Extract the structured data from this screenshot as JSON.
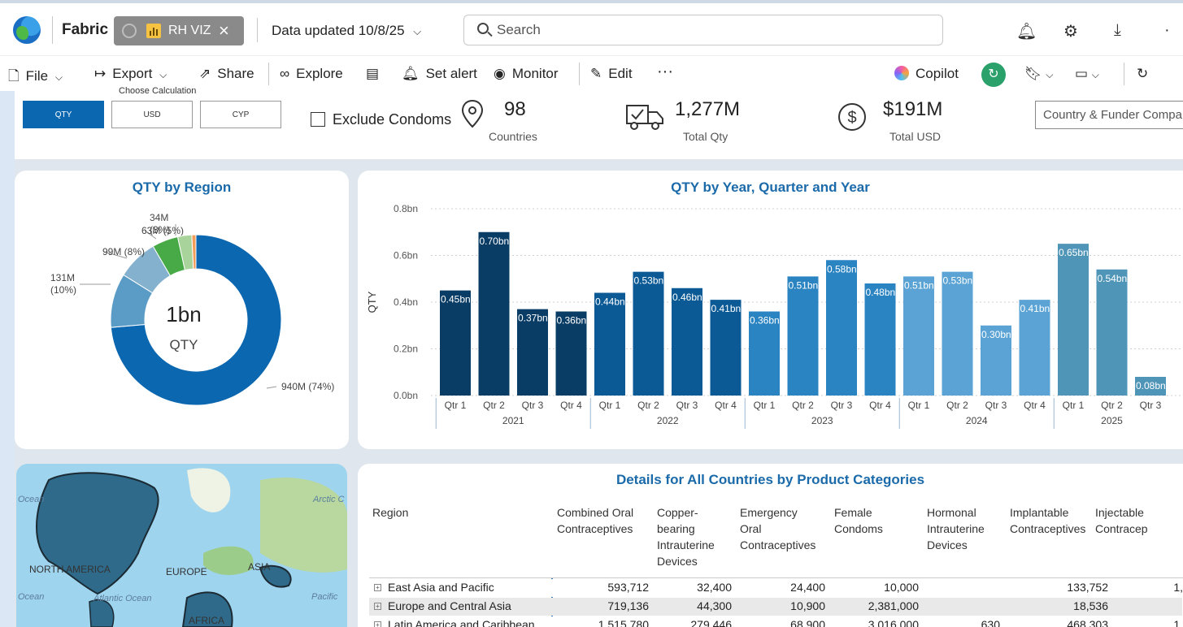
{
  "app": {
    "brand": "Fabric",
    "tab_label": "RH VIZ",
    "data_updated": "Data updated 10/8/25",
    "search_placeholder": "Search"
  },
  "ribbon": {
    "file": "File",
    "export": "Export",
    "share": "Share",
    "explore": "Explore",
    "set_alert": "Set alert",
    "monitor": "Monitor",
    "edit": "Edit",
    "more": "···",
    "copilot": "Copilot"
  },
  "icons": [
    "bell-icon",
    "gear-icon",
    "download-icon",
    "more-icon",
    "file-icon",
    "export-icon",
    "share-icon",
    "binoculars-icon",
    "explore-icon",
    "alert-icon",
    "monitor-icon",
    "edit-icon",
    "copilot-icon",
    "refresh-icon",
    "bookmark-icon",
    "view-icon",
    "reload-icon",
    "location-icon",
    "truck-icon",
    "dollar-icon"
  ],
  "filters": {
    "calc_label": "Choose Calculation",
    "calc_buttons": [
      "QTY",
      "USD",
      "CYP"
    ],
    "calc_selected": "QTY",
    "exclude_label": "Exclude Condoms",
    "exclude_checked": false,
    "slicer_placeholder": "Country & Funder Compa"
  },
  "kpis": {
    "countries": {
      "value": "98",
      "label": "Countries"
    },
    "qty": {
      "value": "1,277M",
      "label": "Total Qty"
    },
    "usd": {
      "value": "$191M",
      "label": "Total USD"
    }
  },
  "donut": {
    "title": "QTY by Region",
    "center_value": "1bn",
    "center_label": "QTY",
    "slices": [
      {
        "value": 940,
        "label": "940M (74%)",
        "color": "#0b67b0"
      },
      {
        "value": 131,
        "label": "131M\n(10%)",
        "color": "#5b9cc7"
      },
      {
        "value": 99,
        "label": "99M (8%)",
        "color": "#84b1ce"
      },
      {
        "value": 63,
        "label": "63M (5%)",
        "color": "#48a947"
      },
      {
        "value": 34,
        "label": "34M\n(3%)",
        "color": "#a8d49b"
      },
      {
        "value": 10,
        "label": "",
        "color": "#f29d5a"
      }
    ]
  },
  "chart_data": {
    "type": "bar",
    "title": "QTY by Year, Quarter and Year",
    "ylabel": "QTY",
    "ylim": [
      0,
      0.8
    ],
    "yticks": [
      "0.0bn",
      "0.2bn",
      "0.4bn",
      "0.6bn",
      "0.8bn"
    ],
    "ytick_values": [
      0,
      0.2,
      0.4,
      0.6,
      0.8
    ],
    "years": [
      "2021",
      "2022",
      "2023",
      "2024",
      "2025"
    ],
    "quarters": [
      "Qtr 1",
      "Qtr 2",
      "Qtr 3",
      "Qtr 4"
    ],
    "year_colors": [
      "#0a3d66",
      "#0b5a96",
      "#2b84c2",
      "#5aa3d4",
      "#4f95b8"
    ],
    "bars": [
      {
        "year": "2021",
        "quarter": "Qtr 1",
        "value": 0.45,
        "label": "0.45bn"
      },
      {
        "year": "2021",
        "quarter": "Qtr 2",
        "value": 0.7,
        "label": "0.70bn"
      },
      {
        "year": "2021",
        "quarter": "Qtr 3",
        "value": 0.37,
        "label": "0.37bn"
      },
      {
        "year": "2021",
        "quarter": "Qtr 4",
        "value": 0.36,
        "label": "0.36bn"
      },
      {
        "year": "2022",
        "quarter": "Qtr 1",
        "value": 0.44,
        "label": "0.44bn"
      },
      {
        "year": "2022",
        "quarter": "Qtr 2",
        "value": 0.53,
        "label": "0.53bn"
      },
      {
        "year": "2022",
        "quarter": "Qtr 3",
        "value": 0.46,
        "label": "0.46bn"
      },
      {
        "year": "2022",
        "quarter": "Qtr 4",
        "value": 0.41,
        "label": "0.41bn"
      },
      {
        "year": "2023",
        "quarter": "Qtr 1",
        "value": 0.36,
        "label": "0.36bn"
      },
      {
        "year": "2023",
        "quarter": "Qtr 2",
        "value": 0.51,
        "label": "0.51bn"
      },
      {
        "year": "2023",
        "quarter": "Qtr 3",
        "value": 0.58,
        "label": "0.58bn"
      },
      {
        "year": "2023",
        "quarter": "Qtr 4",
        "value": 0.48,
        "label": "0.48bn"
      },
      {
        "year": "2024",
        "quarter": "Qtr 1",
        "value": 0.51,
        "label": "0.51bn"
      },
      {
        "year": "2024",
        "quarter": "Qtr 2",
        "value": 0.53,
        "label": "0.53bn"
      },
      {
        "year": "2024",
        "quarter": "Qtr 3",
        "value": 0.3,
        "label": "0.30bn"
      },
      {
        "year": "2024",
        "quarter": "Qtr 4",
        "value": 0.41,
        "label": "0.41bn"
      },
      {
        "year": "2025",
        "quarter": "Qtr 1",
        "value": 0.65,
        "label": "0.65bn"
      },
      {
        "year": "2025",
        "quarter": "Qtr 2",
        "value": 0.54,
        "label": "0.54bn"
      },
      {
        "year": "2025",
        "quarter": "Qtr 3",
        "value": 0.08,
        "label": "0.08bn"
      }
    ]
  },
  "map": {
    "labels": [
      "Ocean",
      "Arctic C",
      "NORTH AMERICA",
      "EUROPE",
      "ASIA",
      "Ocean",
      "Atlantic Ocean",
      "Pacific",
      "AFRICA"
    ]
  },
  "table": {
    "title": "Details for All Countries by Product Categories",
    "columns": [
      "Region",
      "Combined Oral Contraceptives",
      "Copper-bearing Intrauterine Devices",
      "Emergency Oral Contraceptives",
      "Female Condoms",
      "Hormonal Intrauterine Devices",
      "Implantable Contraceptives",
      "Injectable Contraceptives"
    ],
    "column_lines": [
      [
        "Region"
      ],
      [
        "Combined Oral",
        "Contraceptives"
      ],
      [
        "Copper-",
        "bearing",
        "Intrauterine",
        "Devices"
      ],
      [
        "Emergency",
        "Oral",
        "Contraceptives"
      ],
      [
        "Female",
        "Condoms"
      ],
      [
        "Hormonal",
        "Intrauterine",
        "Devices"
      ],
      [
        "Implantable",
        "Contraceptives"
      ],
      [
        "Injectable",
        "Contracep"
      ]
    ],
    "rows": [
      {
        "region": "East Asia and Pacific",
        "cells": [
          "593,712",
          "32,400",
          "24,400",
          "10,000",
          "",
          "133,752",
          "1,"
        ]
      },
      {
        "region": "Europe and Central Asia",
        "cells": [
          "719,136",
          "44,300",
          "10,900",
          "2,381,000",
          "",
          "18,536",
          ""
        ]
      },
      {
        "region": "Latin America and Caribbean",
        "cells": [
          "1,515,780",
          "279,446",
          "68,900",
          "3,016,000",
          "630",
          "468,303",
          "1,"
        ]
      }
    ]
  }
}
